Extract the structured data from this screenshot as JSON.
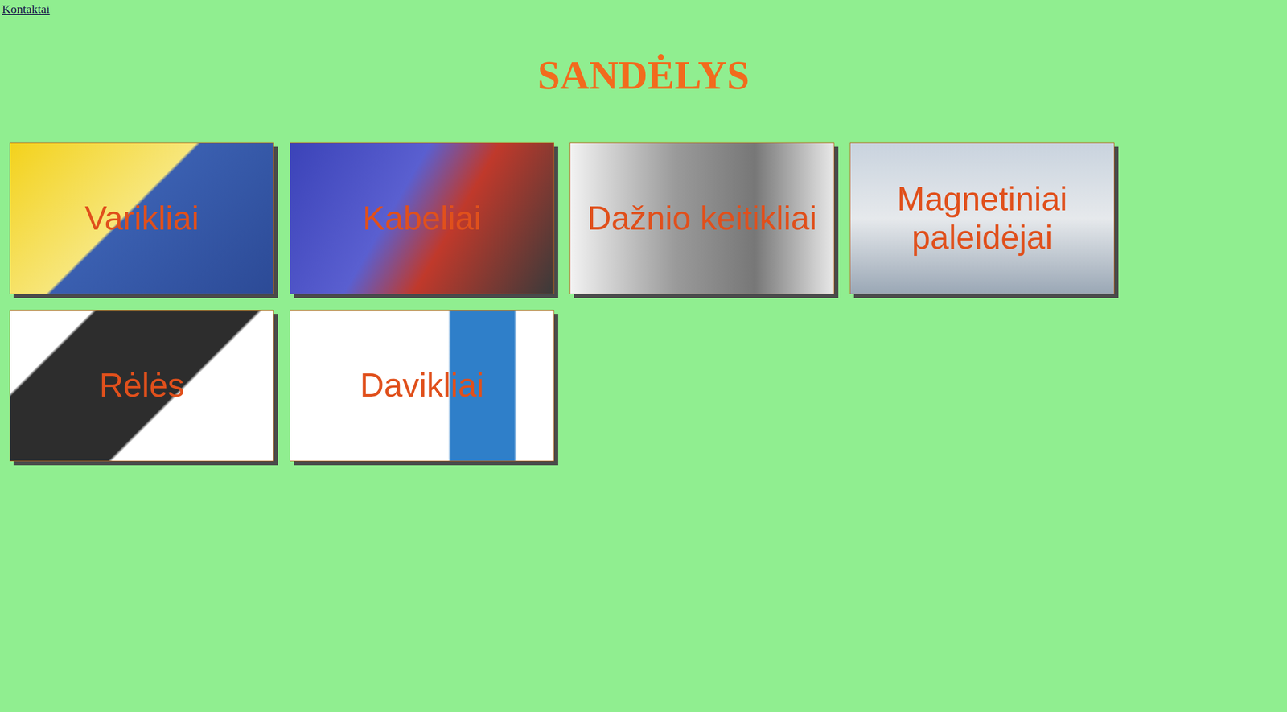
{
  "nav": {
    "link": "Kontaktai"
  },
  "title": "SANDĖLYS",
  "categories": [
    {
      "label": "Varikliai"
    },
    {
      "label": "Kabeliai"
    },
    {
      "label": "Dažnio keitikliai"
    },
    {
      "label": "Magnetiniai paleidėjai"
    },
    {
      "label": "Rėlės"
    },
    {
      "label": "Davikliai"
    }
  ]
}
